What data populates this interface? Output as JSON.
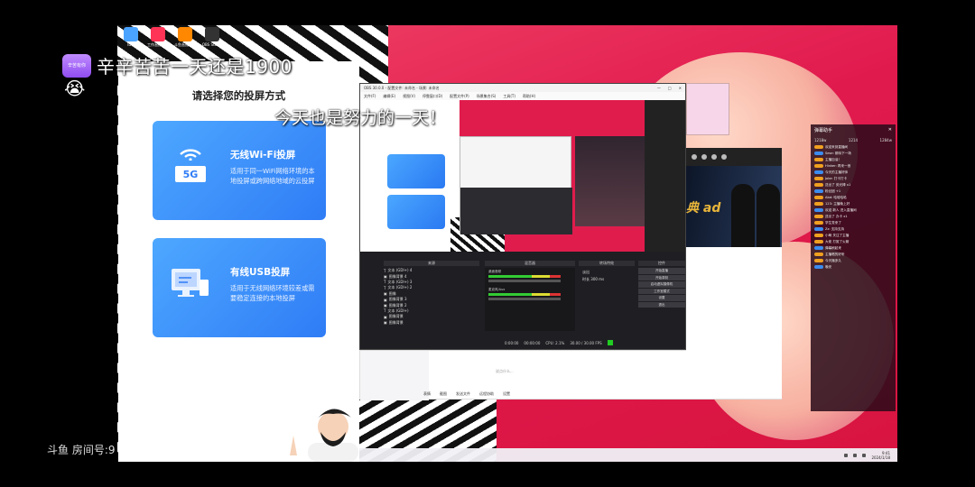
{
  "overlay": {
    "crown_label": "辛苦有你",
    "line1": "辛辛苦苦一天还是1900",
    "emoji": "😭",
    "line2": "今天也是努力的一天！",
    "room_label": "斗鱼 房间号:9"
  },
  "desktop": {
    "icons": [
      "IDM",
      "工作直播伴侣",
      "斗鱼直播工具",
      "OBS Studio"
    ]
  },
  "dialog": {
    "title": "请选择您的投屏方式",
    "wifi": {
      "title": "无线Wi-Fi投屏",
      "desc": "适用于同一WiFi网络环境的本地投屏或跨网络地域的云投屏",
      "badge": "5G"
    },
    "usb": {
      "title": "有线USB投屏",
      "desc": "适用于无线网络环境较差或需要稳定连接的本地投屏"
    }
  },
  "obs": {
    "title": "OBS 30.0.0 - 配置文件: 未命名 - 场景: 未命名",
    "menu": [
      "文件(F)",
      "编辑(E)",
      "视图(V)",
      "停靠窗口(D)",
      "配置文件(P)",
      "场景集合(S)",
      "工具(T)",
      "帮助(H)"
    ],
    "docks": {
      "sources": "来源",
      "mixer": "混音器",
      "transitions": "转场特效",
      "controls": "控件"
    },
    "sources": [
      "文本 (GDI+) 4",
      "图像背景 4",
      "文本 (GDI+) 3",
      "文本 (GDI+) 2",
      "图像",
      "图像背景 3",
      "图像背景 2",
      "文本 (GDI+)",
      "图像背景",
      "图像背景"
    ],
    "controls": [
      "开始直播",
      "开始录制",
      "启动虚拟摄像机",
      "工作室模式",
      "设置",
      "退出"
    ],
    "status": [
      "0:00:00",
      "00:00:00",
      "CPU: 2.1%",
      "30.00 / 30.00 FPS"
    ],
    "mixer_tracks": [
      "桌面音频",
      "麦克风/Aux"
    ],
    "transition": [
      "淡出",
      "时长 300 ms"
    ]
  },
  "chat": {
    "input_placeholder": "说点什么...",
    "footer": [
      "表情",
      "截图",
      "发送文件",
      "远程协助",
      "设置"
    ]
  },
  "danmu": {
    "header": "弹幕助手",
    "stats": [
      "1218w",
      "1214",
      "1284w"
    ],
    "lines": [
      "欢迎来到直播间",
      "Sese: 期待下一场",
      "主播加油！",
      "Hinker: 再来一首",
      "今天的主播好帅",
      "Joke: 打卡打卡",
      "送出了 荧光棒 x1",
      "粉丝团 +1",
      "Abd: 哈哈哈哈",
      "123: 主播晚上好",
      "欢迎 新人 进入直播间",
      "送出了 办卡 x1",
      "学生党来了",
      "Zz: 支持支持",
      "小萌 关注了主播",
      "大佬 打赏了火箭",
      "弹幕刷起来",
      "主播唱的好听",
      "今天播多久",
      "晚安"
    ]
  },
  "taskbar": {
    "time": "9:41",
    "date": "2024/1/18"
  },
  "colors": {
    "accent": "#2f7cf6",
    "background_pink": "#e11a4e"
  }
}
